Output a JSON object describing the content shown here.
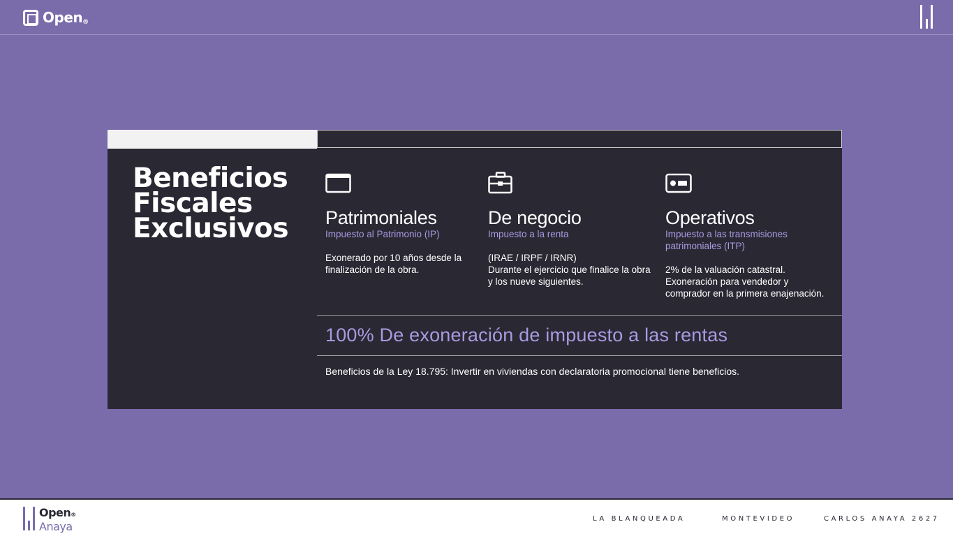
{
  "header": {
    "logo_text": "Open",
    "logo_dot": "®",
    "menu_icon": "menu-bars-icon"
  },
  "card": {
    "title_lines": [
      "Beneficios",
      "Fiscales",
      "Exclusivos"
    ],
    "columns": [
      {
        "icon": "browser-window-icon",
        "title": "Patrimoniales",
        "subtitle": "Impuesto al Patrimonio (IP)",
        "description": "Exonerado por 10 años desde la finalización de la obra."
      },
      {
        "icon": "briefcase-icon",
        "title": "De negocio",
        "subtitle": "Impuesto a la renta",
        "description_lines": [
          "(IRAE / IRPF / IRNR)",
          "Durante el ejercicio que finalice la obra y los nueve siguientes."
        ]
      },
      {
        "icon": "id-card-icon",
        "title": "Operativos",
        "subtitle": "Impuesto a las transmisiones patrimoniales (ITP)",
        "description_lines": [
          "2% de la valuación catastral.",
          "Exoneración para vendedor y comprador en la primera enajenación."
        ]
      }
    ],
    "headline": "100% De exoneración de impuesto a las rentas",
    "law_text": "Beneficios de la Ley 18.795: Invertir en viviendas con declaratoria promocional tiene beneficios."
  },
  "footer": {
    "logo_line1": "Open",
    "logo_dot": "®",
    "logo_line2": "Anaya",
    "items": [
      "LA BLANQUEADA",
      "MONTEVIDEO",
      "CARLOS ANAYA 2627"
    ]
  },
  "colors": {
    "background": "#7a6bab",
    "card": "#2a2833",
    "accent_text": "#a99ae0",
    "footer": "#ffffff"
  }
}
